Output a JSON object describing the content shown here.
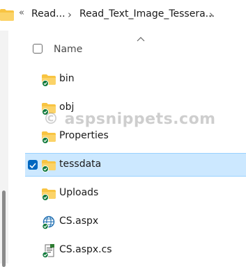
{
  "breadcrumb": {
    "overflow": "«",
    "items": [
      "Read...",
      "Read_Text_Image_Tessera..."
    ],
    "separator": "›"
  },
  "header": {
    "name_label": "Name"
  },
  "files": [
    {
      "name": "bin",
      "icon": "folder-synced-icon"
    },
    {
      "name": "obj",
      "icon": "folder-synced-icon"
    },
    {
      "name": "Properties",
      "icon": "folder-synced-icon"
    },
    {
      "name": "tessdata",
      "icon": "folder-synced-icon",
      "selected": true
    },
    {
      "name": "Uploads",
      "icon": "folder-synced-icon"
    },
    {
      "name": "CS.aspx",
      "icon": "aspx-file-synced-icon"
    },
    {
      "name": "CS.aspx.cs",
      "icon": "cs-file-synced-icon"
    }
  ],
  "watermark": "© aspsnippets.com",
  "colors": {
    "folder": "#f8c442",
    "sync_badge": "#117a3c",
    "selection_bg": "#cce8ff",
    "selection_check": "#0067c0"
  }
}
